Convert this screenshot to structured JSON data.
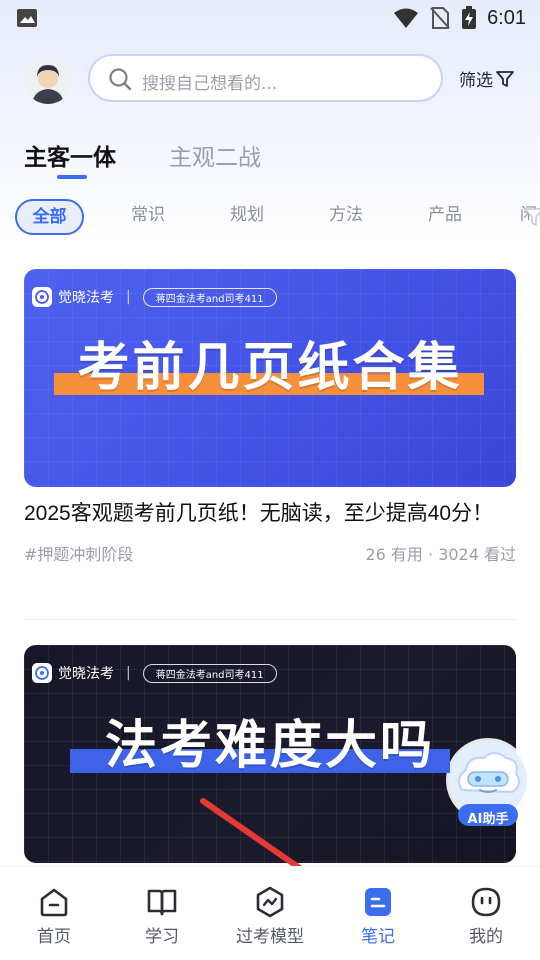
{
  "status_bar": {
    "time": "6:01",
    "icons": [
      "gallery-icon",
      "wifi-icon",
      "no-sim-icon",
      "battery-charging-icon"
    ]
  },
  "search": {
    "placeholder": "搜搜自己想看的...",
    "filter_label": "筛选"
  },
  "main_tabs": [
    {
      "label": "主客一体",
      "active": true
    },
    {
      "label": "主观二战",
      "active": false
    }
  ],
  "categories": [
    {
      "label": "全部",
      "active": true
    },
    {
      "label": "常识"
    },
    {
      "label": "规划"
    },
    {
      "label": "方法"
    },
    {
      "label": "产品"
    },
    {
      "label": "闲"
    }
  ],
  "cards": [
    {
      "brand": "觉晓法考",
      "brand_tag": "蒋四金法考and司考411",
      "banner_title": "考前几页纸合集",
      "title": "2025客观题考前几页纸！无脑读，至少提高40分！",
      "tag": "#押题冲刺阶段",
      "stats": "26 有用 · 3024 看过"
    },
    {
      "brand": "觉晓法考",
      "brand_tag": "蒋四金法考and司考411",
      "banner_title": "法考难度大吗"
    }
  ],
  "ai_assistant": {
    "label": "AI助手"
  },
  "bottom_nav": [
    {
      "label": "首页",
      "icon": "home-icon"
    },
    {
      "label": "学习",
      "icon": "book-icon"
    },
    {
      "label": "过考模型",
      "icon": "model-icon"
    },
    {
      "label": "笔记",
      "icon": "notes-icon",
      "active": true
    },
    {
      "label": "我的",
      "icon": "profile-icon"
    }
  ],
  "colors": {
    "accent": "#3a6df0",
    "banner_blue": "#4a5ced",
    "stripe_orange": "#f7903a",
    "arrow_red": "#e53935"
  }
}
